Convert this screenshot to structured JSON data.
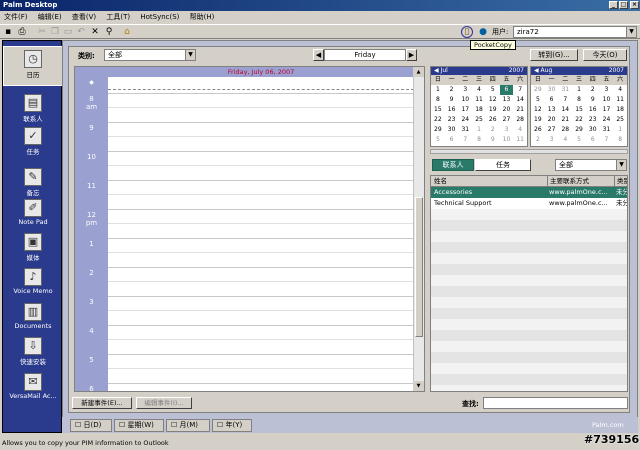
{
  "window": {
    "title": "Palm Desktop",
    "controls": [
      "_",
      "□",
      "×"
    ]
  },
  "menu": [
    "文件(F)",
    "编辑(E)",
    "查看(V)",
    "工具(T)",
    "HotSync(S)",
    "帮助(H)"
  ],
  "toolbar": {
    "user_label": "用户:",
    "user_value": "zira72",
    "tooltip": "PocketCopy"
  },
  "sidebar": [
    {
      "label": "日历",
      "icon": "calendar-icon",
      "glyph": "◷",
      "active": true
    },
    {
      "label": "联系人",
      "icon": "contacts-icon",
      "glyph": "▤"
    },
    {
      "label": "任务",
      "icon": "tasks-icon",
      "glyph": "✓"
    },
    {
      "label": "备忘",
      "icon": "memo-icon",
      "glyph": "✎"
    },
    {
      "label": "Note Pad",
      "icon": "notepad-icon",
      "glyph": "✐"
    },
    {
      "label": "媒体",
      "icon": "media-icon",
      "glyph": "▣"
    },
    {
      "label": "Voice Memo",
      "icon": "microphone-icon",
      "glyph": "♪"
    },
    {
      "label": "Documents",
      "icon": "documents-icon",
      "glyph": "▥"
    },
    {
      "label": "快速安装",
      "icon": "install-icon",
      "glyph": "⇩"
    },
    {
      "label": "VersaMail Ac...",
      "icon": "mail-icon",
      "glyph": "✉"
    }
  ],
  "calendar": {
    "category_label": "类别:",
    "category_value": "全部",
    "day_label": "Friday",
    "date_header": "Friday, July 06, 2007",
    "goto_label": "转到(G)...",
    "today_label": "今天(O)",
    "hours": [
      {
        "h": "8",
        "s": "am"
      },
      {
        "h": "9",
        "s": ""
      },
      {
        "h": "10",
        "s": ""
      },
      {
        "h": "11",
        "s": ""
      },
      {
        "h": "12",
        "s": "pm"
      },
      {
        "h": "1",
        "s": ""
      },
      {
        "h": "2",
        "s": ""
      },
      {
        "h": "3",
        "s": ""
      },
      {
        "h": "4",
        "s": ""
      },
      {
        "h": "5",
        "s": ""
      },
      {
        "h": "6",
        "s": ""
      }
    ],
    "new_event": "新建事件(E)...",
    "edit_event": "编辑事件(I)..."
  },
  "mini_cal": [
    {
      "month": "Jul",
      "year": "2007",
      "weekdays": [
        "日",
        "一",
        "二",
        "三",
        "四",
        "五",
        "六"
      ],
      "rows": [
        [
          "1",
          "2",
          "3",
          "4",
          "5",
          "6",
          "7"
        ],
        [
          "8",
          "9",
          "10",
          "11",
          "12",
          "13",
          "14"
        ],
        [
          "15",
          "16",
          "17",
          "18",
          "19",
          "20",
          "21"
        ],
        [
          "22",
          "23",
          "24",
          "25",
          "26",
          "27",
          "28"
        ],
        [
          "29",
          "30",
          "31",
          "1",
          "2",
          "3",
          "4"
        ],
        [
          "5",
          "6",
          "7",
          "8",
          "9",
          "10",
          "11"
        ]
      ]
    },
    {
      "month": "Aug",
      "year": "2007",
      "weekdays": [
        "日",
        "一",
        "二",
        "三",
        "四",
        "五",
        "六"
      ],
      "rows": [
        [
          "29",
          "30",
          "31",
          "1",
          "2",
          "3",
          "4"
        ],
        [
          "5",
          "6",
          "7",
          "8",
          "9",
          "10",
          "11"
        ],
        [
          "12",
          "13",
          "14",
          "15",
          "16",
          "17",
          "18"
        ],
        [
          "19",
          "20",
          "21",
          "22",
          "23",
          "24",
          "25"
        ],
        [
          "26",
          "27",
          "28",
          "29",
          "30",
          "31",
          "1"
        ],
        [
          "2",
          "3",
          "4",
          "5",
          "6",
          "7",
          "8"
        ]
      ]
    }
  ],
  "contacts": {
    "tab_contacts": "联系人",
    "tab_tasks": "任务",
    "filter": "全部",
    "columns": [
      "姓名",
      "主要联系方式",
      "类别"
    ],
    "rows": [
      [
        "Accessories",
        "www.palmOne.c...",
        "未分"
      ],
      [
        "Technical Support",
        "www.palmOne.c...",
        "未分"
      ]
    ],
    "search_label": "查找:"
  },
  "view_tabs": [
    "日(D)",
    "星期(W)",
    "月(M)",
    "年(Y)"
  ],
  "branding": "Palm.com",
  "status": "Allows you to copy your PIM information to Outlook",
  "watermark": "#739156"
}
